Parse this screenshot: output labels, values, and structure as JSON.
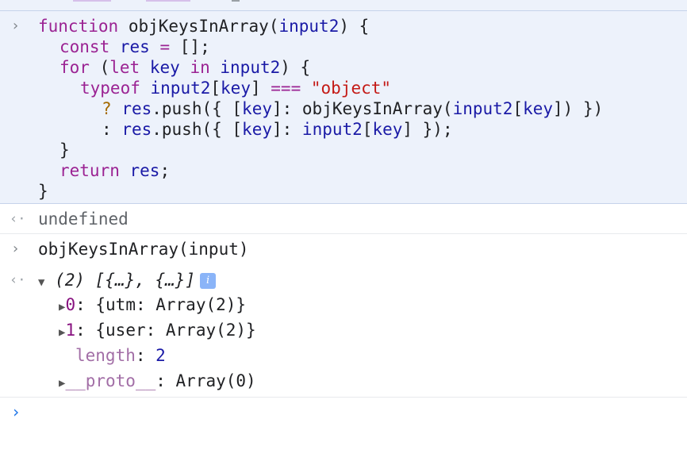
{
  "console": {
    "prompt_glyph": "›",
    "result_glyph": "‹·",
    "entries": {
      "function_def": {
        "lines": [
          {
            "k1": "function",
            "name": "objKeysInArray",
            "p1": "(",
            "arg": "input2",
            "p2": ") {"
          },
          {
            "k": "const",
            "v": "res",
            "op": "=",
            "rest": "[];"
          },
          {
            "k": "for",
            "p1": "(",
            "k2": "let",
            "v": "key",
            "k3": "in",
            "v2": "input2",
            "p2": ") {"
          },
          {
            "k": "typeof",
            "v": "input2",
            "b1": "[",
            "v2": "key",
            "b2": "]",
            "op": "===",
            "s": "\"object\""
          },
          {
            "q": "?",
            "v": "res",
            "call": ".push({ [",
            "v2": "key",
            "mid": "]: objKeysInArray(",
            "v3": "input2",
            "b1": "[",
            "v4": "key",
            "end": "]) })"
          },
          {
            "c": ":",
            "v": "res",
            "call": ".push({ [",
            "v2": "key",
            "mid": "]: ",
            "v3": "input2",
            "b1": "[",
            "v4": "key",
            "end": "] });"
          },
          {
            "t": "}"
          },
          {
            "k": "return",
            "v": "res",
            "t": ";"
          },
          {
            "t": "}"
          }
        ]
      },
      "result1": "undefined",
      "call_expr": "objKeysInArray(input)",
      "array_result": {
        "head": "(2) [{…}, {…}]",
        "info": "i",
        "items": [
          {
            "index": "0",
            "value": "{utm: Array(2)}"
          },
          {
            "index": "1",
            "value": "{user: Array(2)}"
          }
        ],
        "length_key": "length",
        "length_value": "2",
        "proto_key": "__proto__",
        "proto_value": "Array(0)"
      }
    }
  }
}
